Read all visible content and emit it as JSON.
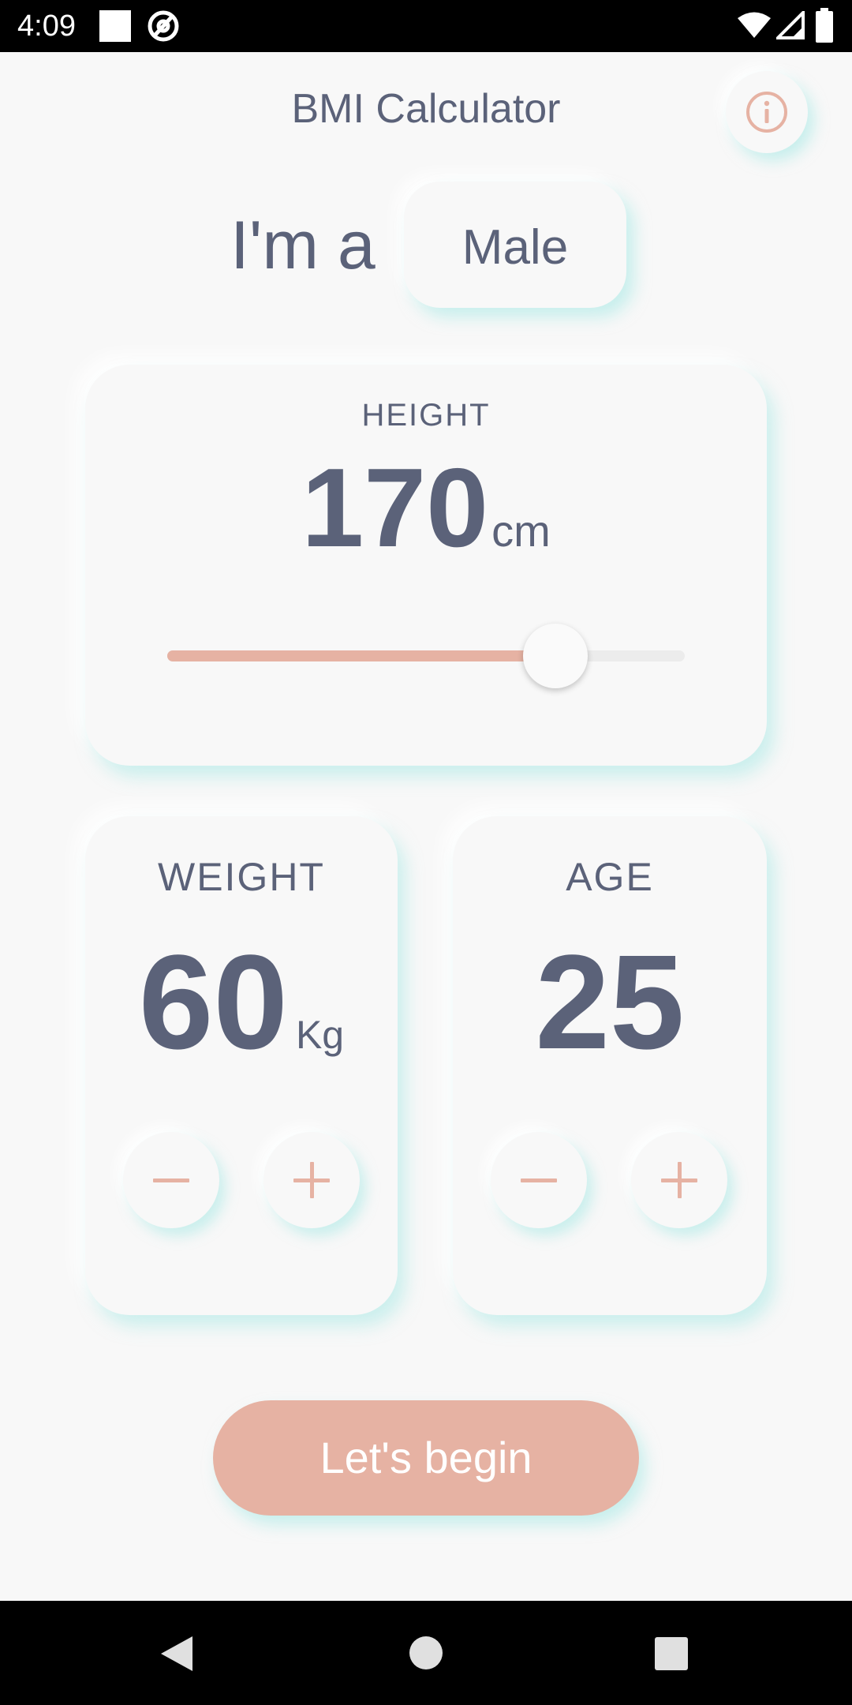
{
  "status_bar": {
    "time": "4:09"
  },
  "header": {
    "title": "BMI Calculator",
    "info_icon": "info-icon"
  },
  "gender": {
    "prefix": "I'm a",
    "value": "Male"
  },
  "height": {
    "label": "HEIGHT",
    "value": "170",
    "unit": "cm",
    "slider_fraction": 0.75
  },
  "weight": {
    "label": "WEIGHT",
    "value": "60",
    "unit": "Kg"
  },
  "age": {
    "label": "AGE",
    "value": "25"
  },
  "action": {
    "begin_label": "Let's begin"
  },
  "colors": {
    "accent": "#e6b2a3",
    "text": "#5b6279",
    "background": "#f8f8f8",
    "shadow": "#a0e8e4"
  }
}
